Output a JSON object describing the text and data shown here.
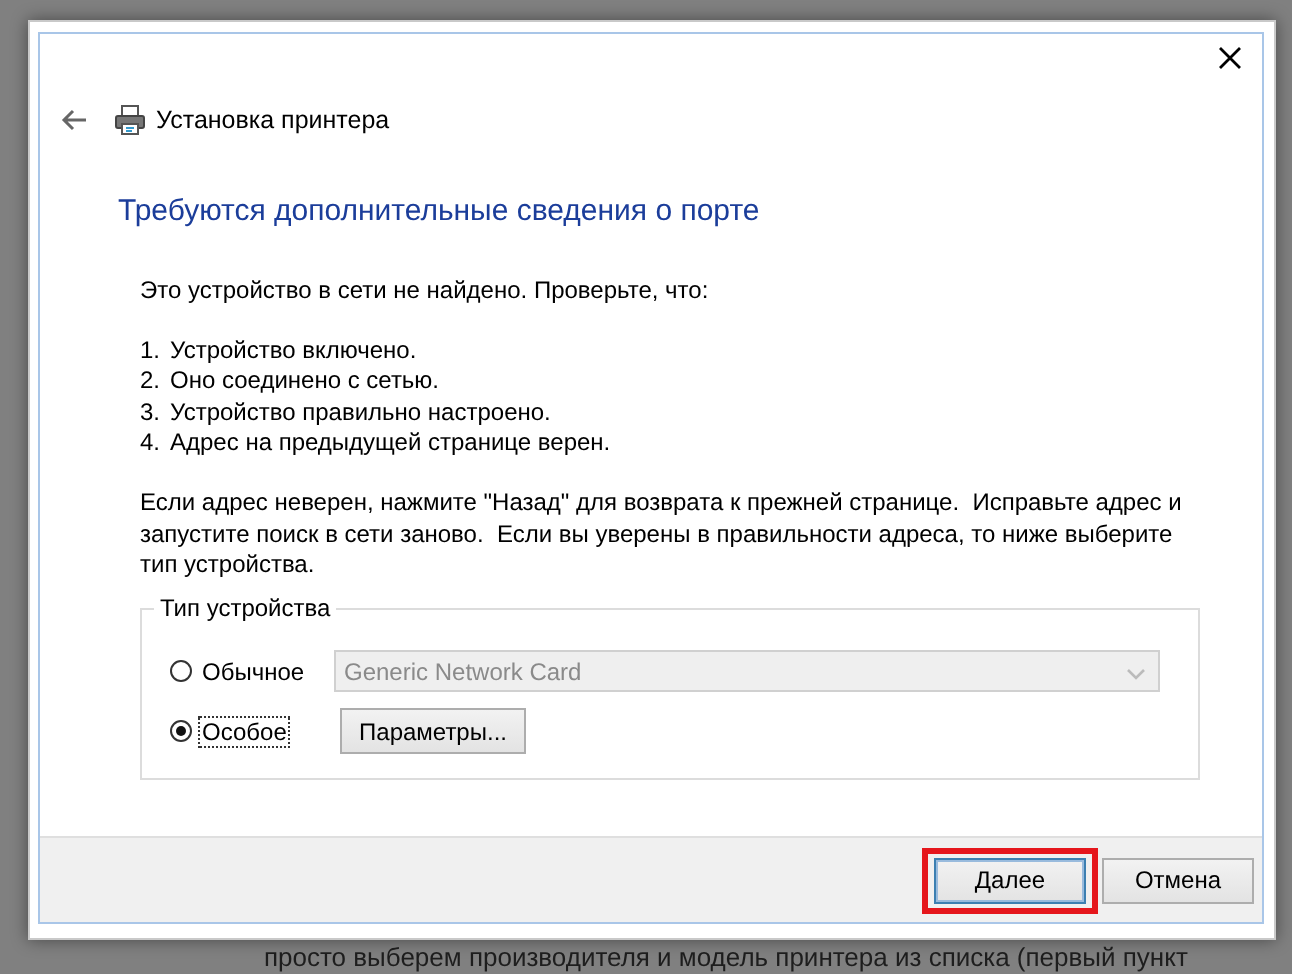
{
  "background_page": {
    "bottom_line": "просто выберем производителя и модель принтера из списка (первый пункт"
  },
  "window": {
    "title": "Установка принтера",
    "heading": "Требуются дополнительные сведения о порте"
  },
  "intro": "Это устройство в сети не найдено. Проверьте, что:",
  "checklist": [
    {
      "number": "1.",
      "text": "Устройство включено."
    },
    {
      "number": "2.",
      "text": "Оно соединено с сетью."
    },
    {
      "number": "3.",
      "text": "Устройство правильно настроено."
    },
    {
      "number": "4.",
      "text": "Адрес на предыдущей странице верен."
    }
  ],
  "advice": "Если адрес неверен, нажмите \"Назад\" для возврата к прежней странице.  Исправьте адрес и запустите поиск в сети заново.  Если вы уверены в правильности адреса, то ниже выберите тип устройства.",
  "device_type": {
    "label": "Тип устройства",
    "options": [
      {
        "kind": "dropdown",
        "label": "Обычное",
        "selected": false,
        "value": "Generic Network Card",
        "disabled": true
      },
      {
        "kind": "button",
        "label": "Особое",
        "selected": true,
        "button": "Параметры...",
        "focused": true
      }
    ]
  },
  "buttons": [
    {
      "label": "Далее",
      "default": true,
      "highlighted": true
    },
    {
      "label": "Отмена",
      "default": false,
      "highlighted": false
    }
  ]
}
